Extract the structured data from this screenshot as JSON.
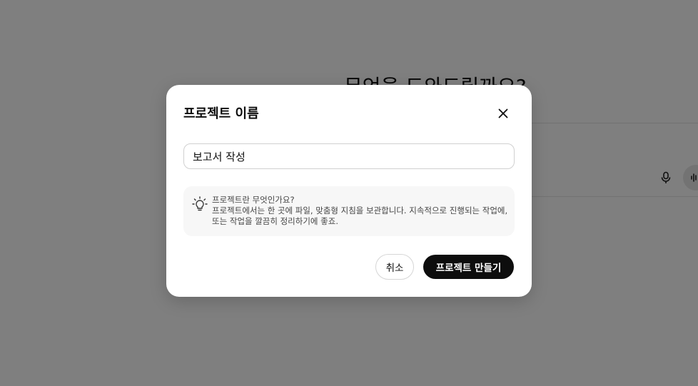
{
  "background": {
    "heading": "무엇을 도와드릴까요?",
    "icons": [
      "microphone-icon",
      "voice-mode-icon"
    ]
  },
  "dialog": {
    "title": "프로젝트 이름",
    "close_icon": "close-icon",
    "name_value": "보고서 작성",
    "info": {
      "icon": "lightbulb-icon",
      "heading": "프로젝트란 무엇인가요?",
      "body": "프로젝트에서는 한 곳에 파일, 맞춤형 지침을 보관합니다. 지속적으로 진행되는 작업에, 또는 작업을 깔끔히 정리하기에 좋죠."
    },
    "cancel_label": "취소",
    "create_label": "프로젝트 만들기"
  },
  "colors": {
    "overlay": "#7f7f7f",
    "modal_bg": "#ffffff",
    "primary_button": "#0d0d0d",
    "info_bg": "#f7f7f7"
  }
}
